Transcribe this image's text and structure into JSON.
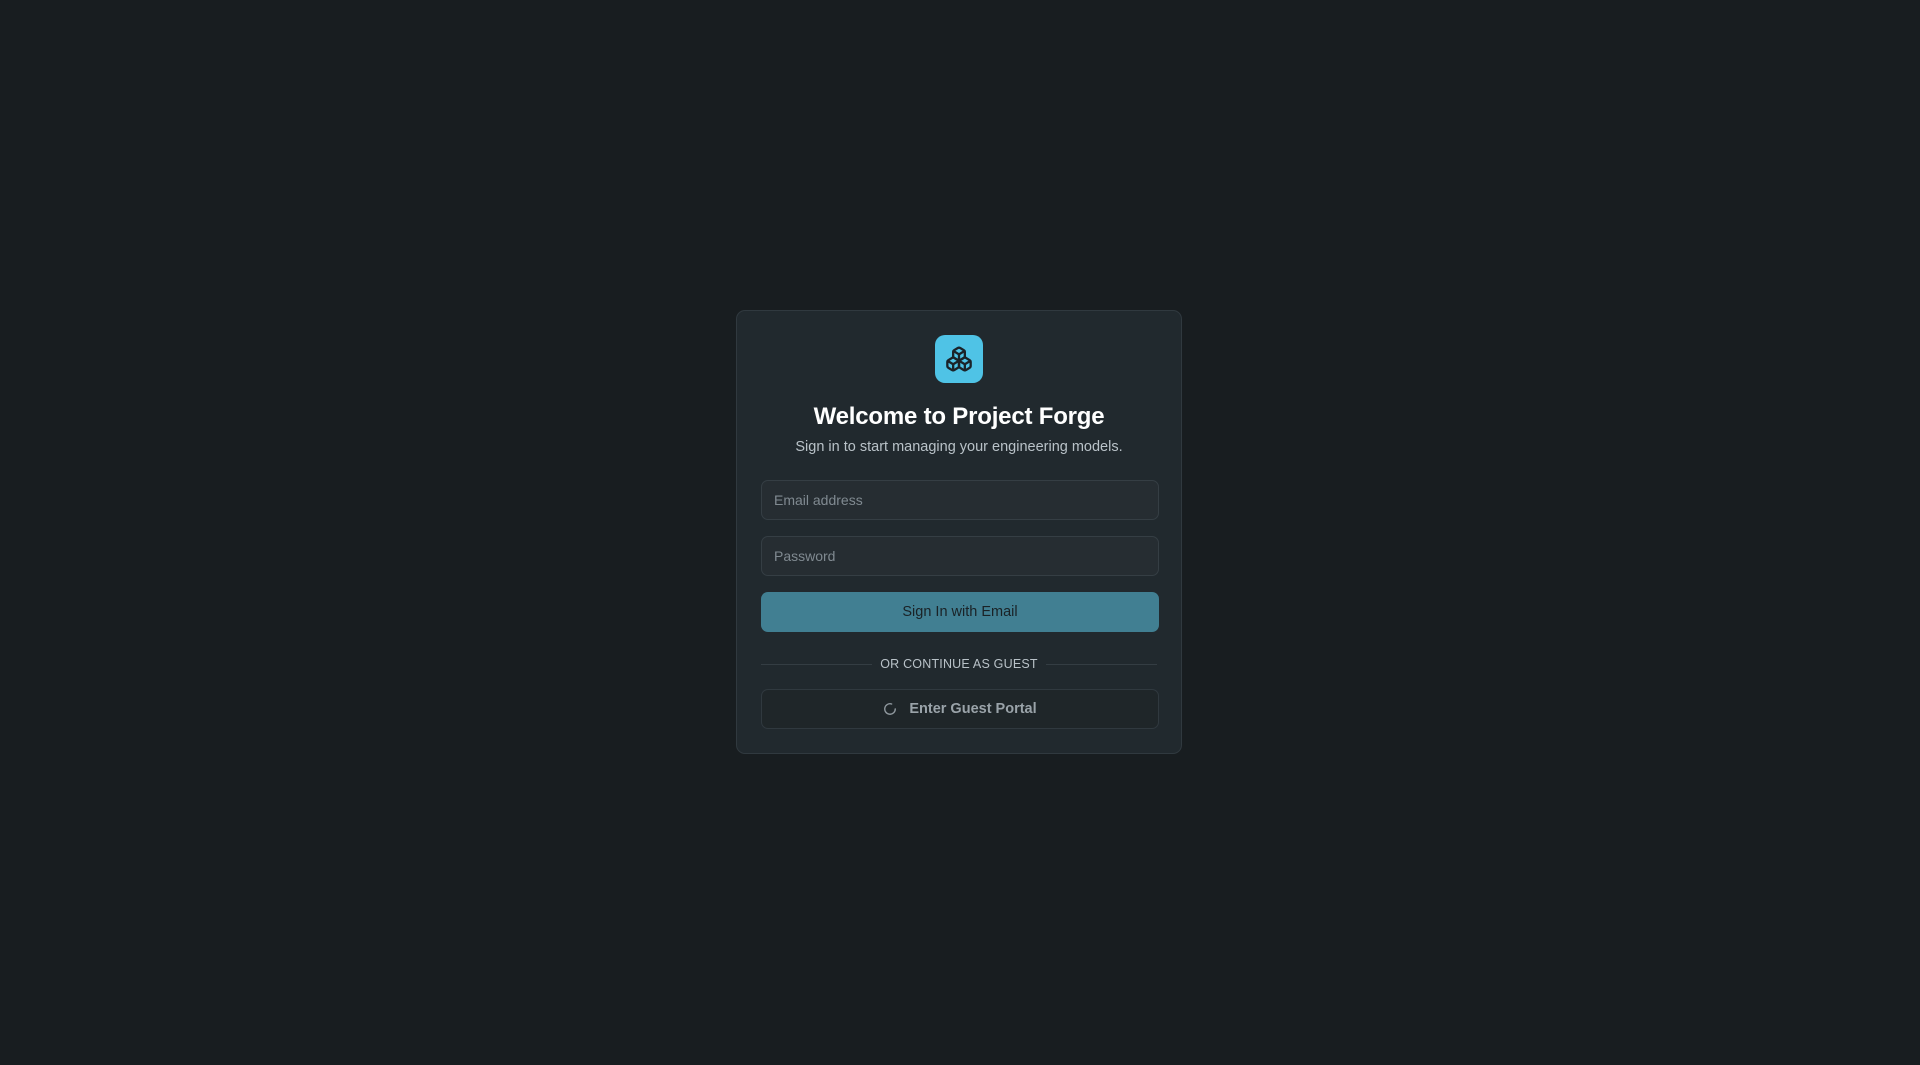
{
  "app": {
    "logo_icon": "boxes-icon",
    "accent_color": "#4fc3e6"
  },
  "auth": {
    "title": "Welcome to Project Forge",
    "subtitle": "Sign in to start managing your engineering models.",
    "email": {
      "placeholder": "Email address",
      "value": ""
    },
    "password": {
      "placeholder": "Password",
      "value": ""
    },
    "sign_in_label": "Sign In with Email",
    "divider_label": "OR CONTINUE AS GUEST",
    "guest": {
      "label": "Enter Guest Portal",
      "icon": "loading-spinner-icon"
    }
  }
}
